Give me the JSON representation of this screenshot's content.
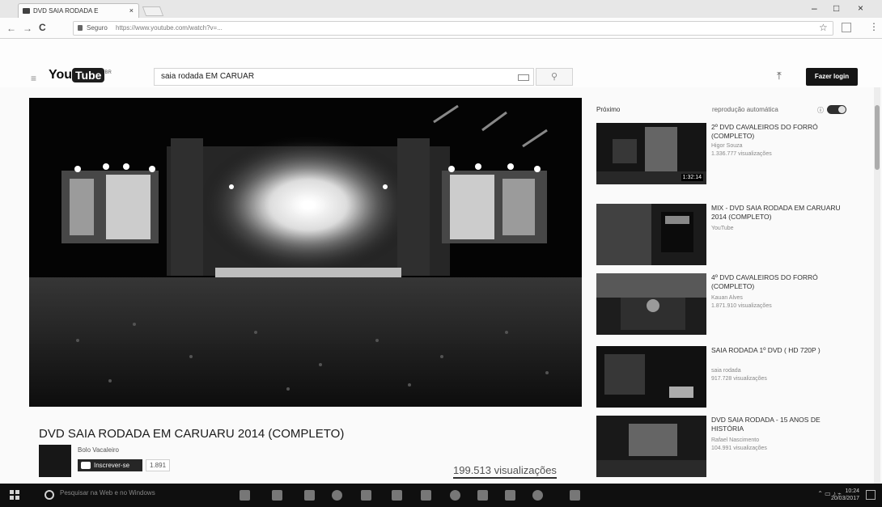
{
  "browser": {
    "tab_title": "DVD SAIA RODADA E",
    "tab_close": "×",
    "address_secure": "Seguro",
    "url": "https://www.youtube.com/watch?v=...",
    "window_minimize": "–",
    "window_maximize": "□",
    "window_close": "×"
  },
  "header": {
    "logo_you": "You",
    "logo_tube": "Tube",
    "logo_region": "BR",
    "search_query": "saia rodada EM CARUAR",
    "signin_label": "Fazer login"
  },
  "video": {
    "title": "DVD SAIA RODADA EM CARUARU 2014 (COMPLETO)",
    "channel": "Bolo Vacaleiro",
    "subscribe_label": "Inscrever-se",
    "subscriber_count": "1.891",
    "views": "199.513 visualizações"
  },
  "sidebar": {
    "next_label": "Próximo",
    "autoplay_label": "reprodução automática",
    "info_icon": "ⓘ",
    "items": [
      {
        "title": "2º DVD CAVALEIROS DO FORRÓ (COMPLETO)",
        "channel": "Higor Souza",
        "views": "1.336.777 visualizações",
        "duration": "1:32:14"
      },
      {
        "title": "Mix - DVD SAIA RODADA EM CARUARU 2014 (COMPLETO)",
        "channel": "YouTube",
        "views": "",
        "duration": ""
      },
      {
        "title": "4º DVD CAVALEIROS DO FORRÓ (COMPLETO)",
        "channel": "Kauan Alves",
        "views": "1.871.910 visualizações",
        "duration": ""
      },
      {
        "title": "SAIA RODADA 1º DVD ( HD 720p )",
        "channel": "saia rodada",
        "views": "917.728 visualizações",
        "duration": ""
      },
      {
        "title": "DVD SAIA RODADA - 15 ANOS DE HISTÓRIA",
        "channel": "Rafael Nascimento",
        "views": "104.991 visualizações",
        "duration": ""
      }
    ]
  },
  "taskbar": {
    "search_placeholder": "Pesquisar na Web e no Windows",
    "time": "10:24",
    "date": "20/03/2017"
  }
}
